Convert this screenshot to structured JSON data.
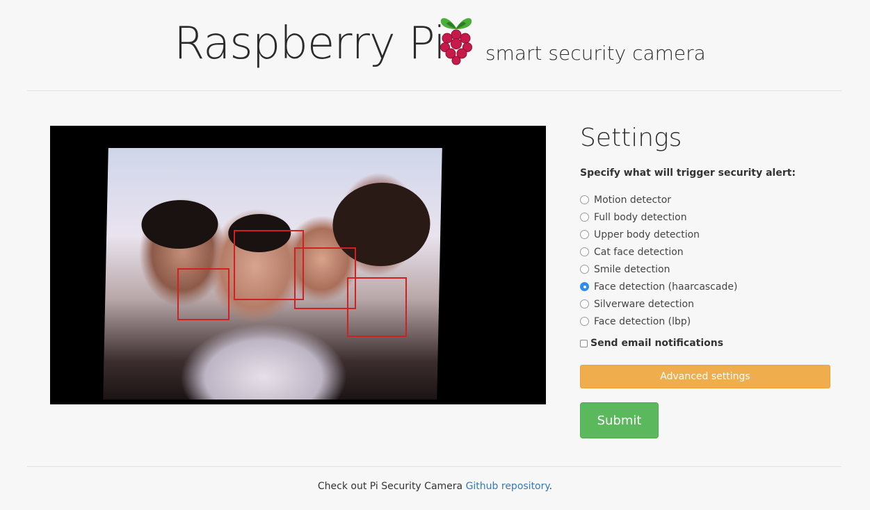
{
  "header": {
    "title": "Raspberry Pi",
    "subtitle": "smart security camera",
    "logo_icon": "raspberry-pi-logo-icon"
  },
  "camera_feed": {
    "detections": 4,
    "box_color": "#d21f1f"
  },
  "settings": {
    "title": "Settings",
    "prompt": "Specify what will trigger security alert:",
    "options": [
      {
        "label": "Motion detector",
        "checked": false
      },
      {
        "label": "Full body detection",
        "checked": false
      },
      {
        "label": "Upper body detection",
        "checked": false
      },
      {
        "label": "Cat face detection",
        "checked": false
      },
      {
        "label": "Smile detection",
        "checked": false
      },
      {
        "label": "Face detection (haarcascade)",
        "checked": true
      },
      {
        "label": "Silverware detection",
        "checked": false
      },
      {
        "label": "Face detection (lbp)",
        "checked": false
      }
    ],
    "email_label": "Send email notifications",
    "email_checked": false,
    "advanced_label": "Advanced settings",
    "submit_label": "Submit"
  },
  "footer": {
    "text": "Check out Pi Security Camera ",
    "link_text": "Github repository",
    "trailing": "."
  },
  "colors": {
    "accent_blue": "#2d8cf0",
    "warning": "#f0ad4e",
    "success": "#5cb85c",
    "link": "#337ab7"
  }
}
